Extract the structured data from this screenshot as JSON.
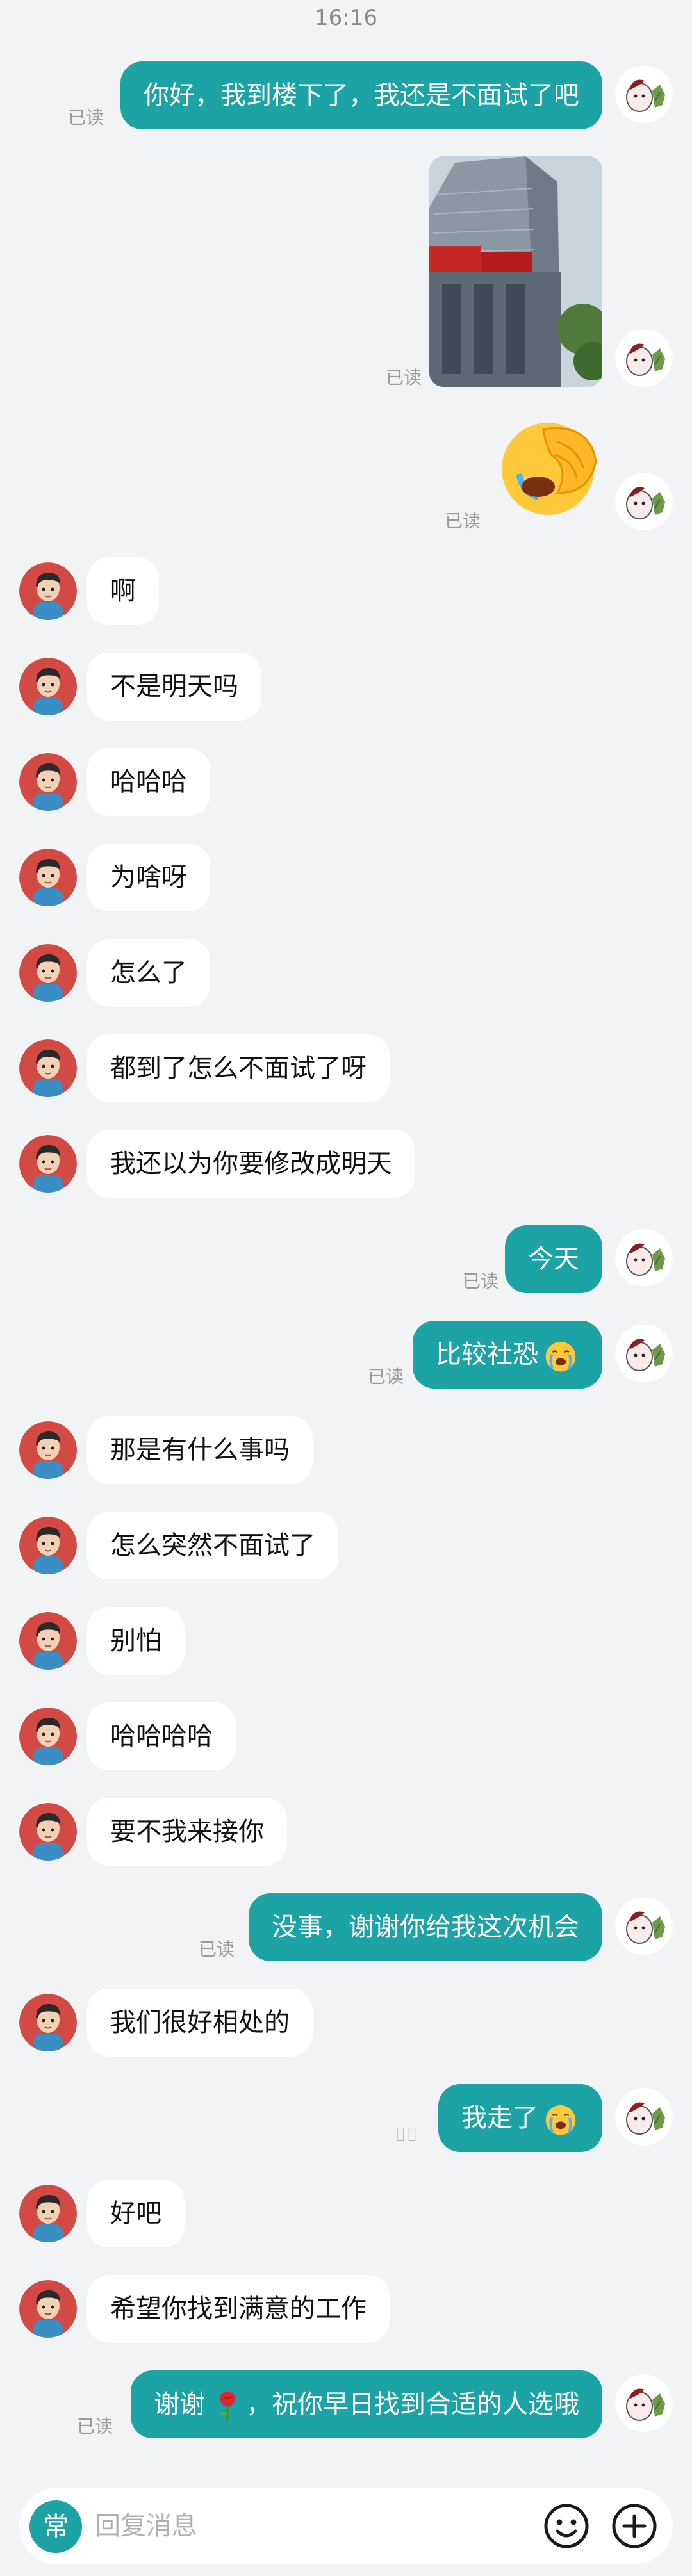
{
  "status": {
    "time": "16:16"
  },
  "read_label": "已读",
  "messages": {
    "m1": {
      "text": "你好，我到楼下了，我还是不面试了吧"
    },
    "m4": {
      "text": "啊"
    },
    "m5": {
      "text": "不是明天吗"
    },
    "m6": {
      "text": "哈哈哈"
    },
    "m7": {
      "text": "为啥呀"
    },
    "m8": {
      "text": "怎么了"
    },
    "m9": {
      "text": "都到了怎么不面试了呀"
    },
    "m10": {
      "text": "我还以为你要修改成明天"
    },
    "m11": {
      "text": "今天"
    },
    "m12": {
      "text": "比较社恐"
    },
    "m13": {
      "text": "那是有什么事吗"
    },
    "m14": {
      "text": "怎么突然不面试了"
    },
    "m15": {
      "text": "别怕"
    },
    "m16": {
      "text": "哈哈哈哈"
    },
    "m17": {
      "text": "要不我来接你"
    },
    "m18": {
      "text": "没事，谢谢你给我这次机会"
    },
    "m19": {
      "text": "我们很好相处的"
    },
    "m20": {
      "text": "我走了"
    },
    "m21": {
      "text": "好吧"
    },
    "m22": {
      "text": "希望你找到满意的工作"
    },
    "m23": {
      "text_a": "谢谢",
      "text_b": "，祝你早日找到合适的人选哦"
    }
  },
  "input": {
    "quick_label": "常",
    "placeholder": "回复消息"
  },
  "colors": {
    "outgoing_bubble": "#1ca3a6",
    "incoming_bubble": "#ffffff",
    "background": "#f2f3f5"
  },
  "icons": [
    "user-avatar-icon",
    "contact-avatar-icon",
    "crying-emoji-icon",
    "rose-emoji-icon",
    "smile-icon",
    "plus-icon"
  ]
}
